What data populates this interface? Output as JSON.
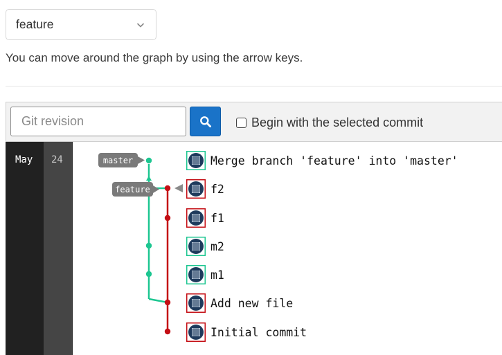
{
  "branch_select": {
    "value": "feature"
  },
  "hint": "You can move around the graph by using the arrow keys.",
  "toolbar": {
    "revision_placeholder": "Git revision",
    "search_icon": "search-icon",
    "checkbox_label": "Begin with the selected commit",
    "checkbox_checked": false
  },
  "graph": {
    "month": "May",
    "day": "24",
    "colors": {
      "master": "#1dc691",
      "feature": "#c40e14"
    },
    "refs": [
      "master",
      "feature"
    ],
    "commits": [
      {
        "message": "Merge branch 'feature' into 'master'",
        "branch": "master"
      },
      {
        "message": "f2",
        "branch": "feature"
      },
      {
        "message": "f1",
        "branch": "feature"
      },
      {
        "message": "m2",
        "branch": "master"
      },
      {
        "message": "m1",
        "branch": "master"
      },
      {
        "message": "Add new file",
        "branch": "feature"
      },
      {
        "message": "Initial commit",
        "branch": "feature"
      }
    ]
  }
}
